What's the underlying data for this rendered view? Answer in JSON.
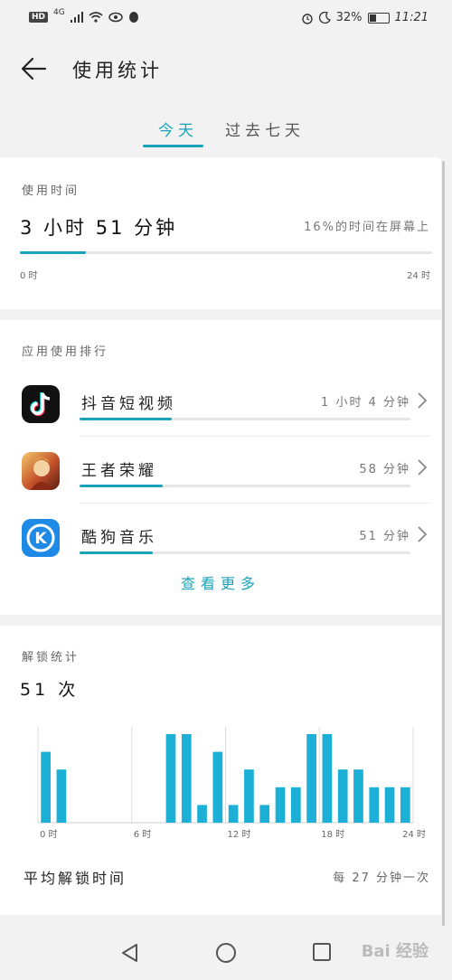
{
  "status_bar": {
    "hd": "HD",
    "network": "4G",
    "battery_percent": "32%",
    "battery_level": 0.32,
    "time": "11:21",
    "left_icons": [
      "signal-icon",
      "wifi-icon",
      "eye-icon",
      "qq-icon"
    ],
    "right_icons": [
      "alarm-icon",
      "moon-icon",
      "battery-icon"
    ]
  },
  "header": {
    "title": "使用统计",
    "back_icon": "back-arrow-icon"
  },
  "tabs": [
    {
      "label": "今天",
      "active": true
    },
    {
      "label": "过去七天",
      "active": false
    }
  ],
  "usage": {
    "section_title": "使用时间",
    "total": "3 小时 51 分钟",
    "percent_text": "16%的时间在屏幕上",
    "progress": 0.16,
    "axis_min": "0 时",
    "axis_max": "24 时"
  },
  "apps": {
    "section_title": "应用使用排行",
    "items": [
      {
        "name": "抖音短视频",
        "time": "1 小时 4 分钟",
        "bar": 0.28,
        "icon": "douyin-icon"
      },
      {
        "name": "王者荣耀",
        "time": "58 分钟",
        "bar": 0.25,
        "icon": "honor-of-kings-icon"
      },
      {
        "name": "酷狗音乐",
        "time": "51 分钟",
        "bar": 0.22,
        "icon": "kugou-icon"
      }
    ],
    "see_more": "查看更多"
  },
  "unlock": {
    "section_title": "解锁统计",
    "count": "51 次",
    "avg_label": "平均解锁时间",
    "avg_value": "每 27 分钟一次"
  },
  "chart_data": {
    "type": "bar",
    "title": "",
    "xlabel": "",
    "ylabel": "",
    "x_ticks": [
      "0 时",
      "6 时",
      "12 时",
      "18 时",
      "24 时"
    ],
    "x": [
      0,
      1,
      8,
      9,
      10,
      11,
      12,
      13,
      14,
      15,
      16,
      17,
      18,
      19,
      20,
      21,
      22,
      23
    ],
    "values": [
      4,
      3,
      5,
      5,
      1,
      4,
      1,
      3,
      1,
      2,
      2,
      5,
      5,
      3,
      3,
      2,
      2,
      2
    ],
    "xlim": [
      0,
      24
    ],
    "ylim": [
      0,
      5
    ],
    "color": "#1cb0d6",
    "grid": true
  },
  "nav_bar": {
    "buttons": [
      "back-triangle-icon",
      "home-circle-icon",
      "recents-square-icon"
    ],
    "watermark": "Bai 经验"
  }
}
